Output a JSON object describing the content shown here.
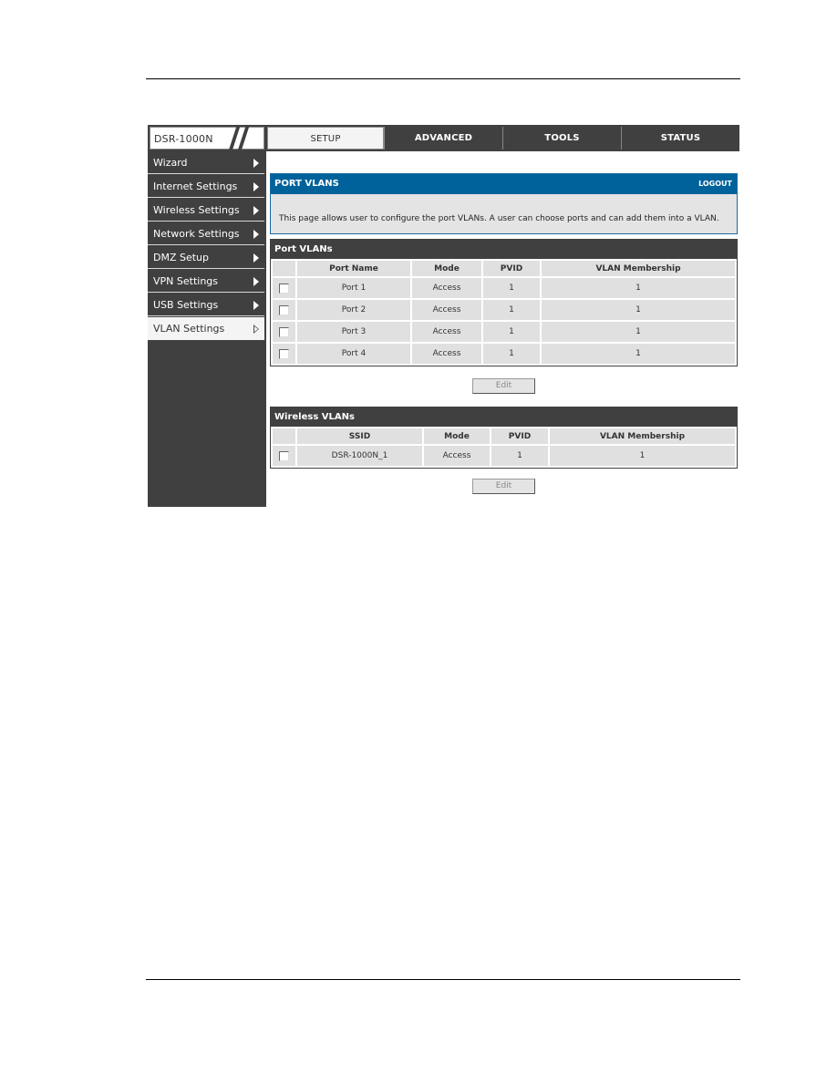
{
  "brand": "DSR-1000N",
  "tabs": [
    {
      "label": "SETUP",
      "active": true
    },
    {
      "label": "ADVANCED",
      "active": false
    },
    {
      "label": "TOOLS",
      "active": false
    },
    {
      "label": "STATUS",
      "active": false
    }
  ],
  "sidebar": {
    "items": [
      {
        "label": "Wizard"
      },
      {
        "label": "Internet Settings"
      },
      {
        "label": "Wireless Settings"
      },
      {
        "label": "Network Settings"
      },
      {
        "label": "DMZ Setup"
      },
      {
        "label": "VPN Settings"
      },
      {
        "label": "USB Settings"
      },
      {
        "label": "VLAN Settings",
        "active": true
      }
    ]
  },
  "info": {
    "title": "PORT VLANS",
    "logout": "LOGOUT",
    "description": "This page allows user to configure the port VLANs. A user can choose ports and can add them into a VLAN."
  },
  "port_vlans": {
    "title": "Port VLANs",
    "headers": [
      "Port Name",
      "Mode",
      "PVID",
      "VLAN Membership"
    ],
    "rows": [
      {
        "name": "Port 1",
        "mode": "Access",
        "pvid": "1",
        "membership": "1"
      },
      {
        "name": "Port 2",
        "mode": "Access",
        "pvid": "1",
        "membership": "1"
      },
      {
        "name": "Port 3",
        "mode": "Access",
        "pvid": "1",
        "membership": "1"
      },
      {
        "name": "Port 4",
        "mode": "Access",
        "pvid": "1",
        "membership": "1"
      }
    ],
    "edit_label": "Edit"
  },
  "wireless_vlans": {
    "title": "Wireless VLANs",
    "headers": [
      "SSID",
      "Mode",
      "PVID",
      "VLAN Membership"
    ],
    "rows": [
      {
        "name": "DSR-1000N_1",
        "mode": "Access",
        "pvid": "1",
        "membership": "1"
      }
    ],
    "edit_label": "Edit"
  },
  "colors": {
    "nav_dark": "#404040",
    "header_blue": "#00629b",
    "cell_gray": "#e0e0e0"
  }
}
